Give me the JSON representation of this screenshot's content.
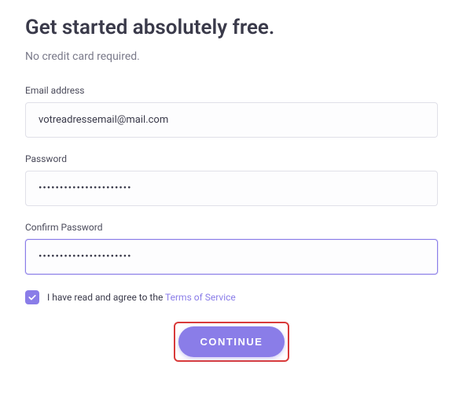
{
  "header": {
    "title": "Get started absolutely free.",
    "subtitle": "No credit card required."
  },
  "form": {
    "email": {
      "label": "Email address",
      "value": "votreadressemail@mail.com"
    },
    "password": {
      "label": "Password",
      "value": "••••••••••••••••••••••"
    },
    "confirm_password": {
      "label": "Confirm Password",
      "value": "••••••••••••••••••••••"
    },
    "agree": {
      "checked": true,
      "prefix": "I have read and agree to the ",
      "link": "Terms of Service"
    },
    "submit_label": "CONTINUE"
  }
}
